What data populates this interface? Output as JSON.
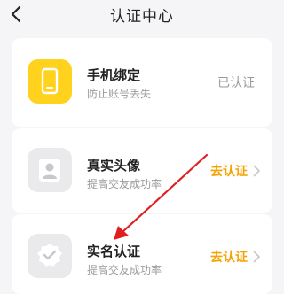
{
  "header": {
    "title": "认证中心"
  },
  "items": [
    {
      "title": "手机绑定",
      "subtitle": "防止账号丢失",
      "status": "已认证"
    },
    {
      "title": "真实头像",
      "subtitle": "提高交友成功率",
      "action": "去认证"
    },
    {
      "title": "实名认证",
      "subtitle": "提高交友成功率",
      "action": "去认证"
    }
  ],
  "colors": {
    "accent": "#f5a300",
    "phone_icon_bg": "#ffd21e",
    "annotation_arrow": "#e02020"
  }
}
